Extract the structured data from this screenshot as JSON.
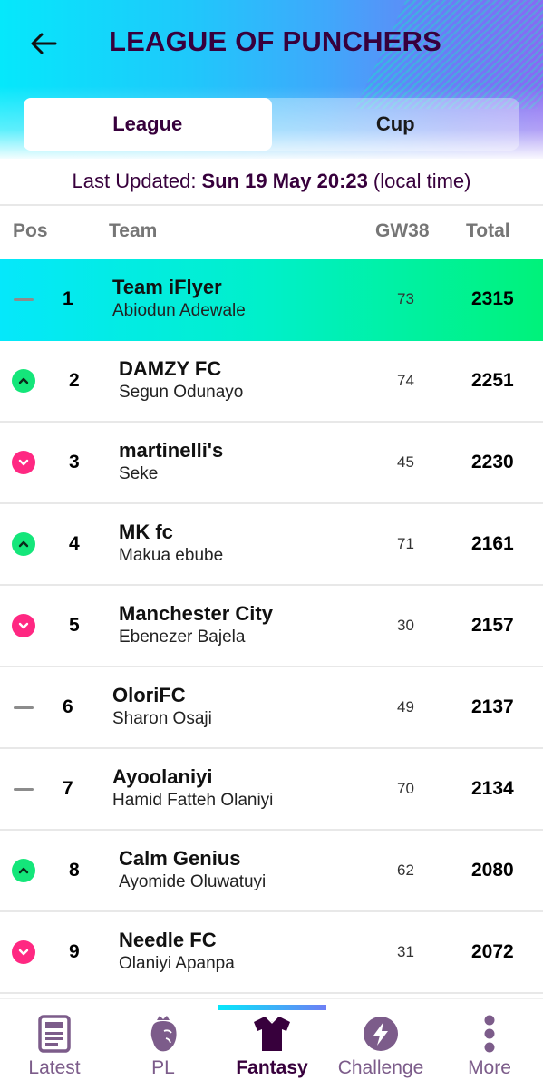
{
  "header": {
    "title": "LEAGUE OF PUNCHERS",
    "back_icon": "arrow-left-icon"
  },
  "tabs": [
    {
      "label": "League",
      "active": true
    },
    {
      "label": "Cup",
      "active": false
    }
  ],
  "last_updated": {
    "prefix": "Last Updated:",
    "datetime": "Sun 19 May 20:23",
    "suffix": "(local time)"
  },
  "columns": {
    "pos": "Pos",
    "team": "Team",
    "gw": "GW38",
    "total": "Total"
  },
  "standings": [
    {
      "pos": "1",
      "movement": "same",
      "team": "Team iFlyer",
      "manager": "Abiodun Adewale",
      "gw": "73",
      "total": "2315",
      "highlight": true
    },
    {
      "pos": "2",
      "movement": "up",
      "team": "DAMZY FC",
      "manager": "Segun Odunayo",
      "gw": "74",
      "total": "2251"
    },
    {
      "pos": "3",
      "movement": "down",
      "team": "martinelli's",
      "manager": "Seke",
      "gw": "45",
      "total": "2230"
    },
    {
      "pos": "4",
      "movement": "up",
      "team": "MK fc",
      "manager": "Makua ebube",
      "gw": "71",
      "total": "2161"
    },
    {
      "pos": "5",
      "movement": "down",
      "team": "Manchester City",
      "manager": "Ebenezer Bajela",
      "gw": "30",
      "total": "2157"
    },
    {
      "pos": "6",
      "movement": "same",
      "team": "OloriFC",
      "manager": "Sharon Osaji",
      "gw": "49",
      "total": "2137"
    },
    {
      "pos": "7",
      "movement": "same",
      "team": "Ayoolaniyi",
      "manager": "Hamid Fatteh Olaniyi",
      "gw": "70",
      "total": "2134"
    },
    {
      "pos": "8",
      "movement": "up",
      "team": "Calm Genius",
      "manager": "Ayomide Oluwatuyi",
      "gw": "62",
      "total": "2080"
    },
    {
      "pos": "9",
      "movement": "down",
      "team": "Needle FC",
      "manager": "Olaniyi Apanpa",
      "gw": "31",
      "total": "2072"
    }
  ],
  "bottom_nav": [
    {
      "label": "Latest",
      "icon": "news-icon",
      "active": false
    },
    {
      "label": "PL",
      "icon": "lion-crest-icon",
      "active": false
    },
    {
      "label": "Fantasy",
      "icon": "shirt-icon",
      "active": true
    },
    {
      "label": "Challenge",
      "icon": "lightning-icon",
      "active": false
    },
    {
      "label": "More",
      "icon": "more-vertical-icon",
      "active": false
    }
  ],
  "colors": {
    "brand_purple": "#37003c",
    "up_green": "#14e67a",
    "down_pink": "#ff2882",
    "nav_inactive": "#7c5c8a"
  }
}
